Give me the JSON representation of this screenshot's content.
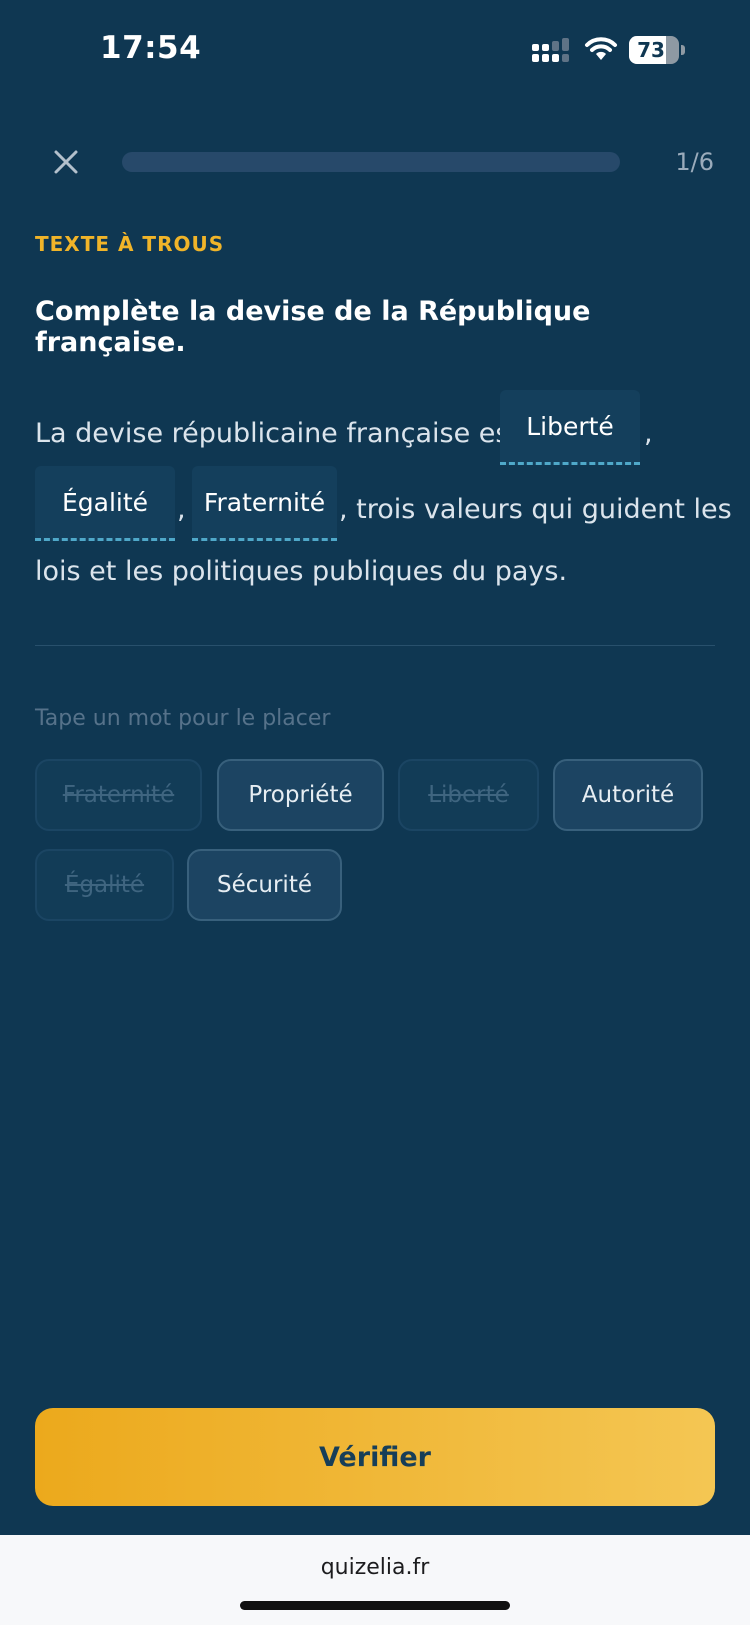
{
  "status_bar": {
    "time": "17:54",
    "battery": "73",
    "battery_level": 0.73,
    "icons": [
      "signal-icon",
      "wifi-icon",
      "battery-icon"
    ]
  },
  "header": {
    "close_icon": "close-icon",
    "progress": 0.0,
    "count": "1/6"
  },
  "exercise": {
    "type_label": "TEXTE À TROUS",
    "question": "Complète la devise de la République française.",
    "sentence": {
      "part1": "La devise républicaine française est",
      "blank1": "Liberté",
      "comma1": ",",
      "blank2": "Égalité",
      "comma2": ",",
      "blank3": "Fraternité",
      "part2": ", trois valeurs qui guident les",
      "part3": "lois et les politiques publiques du pays."
    }
  },
  "word_bank": {
    "hint": "Tape un mot pour le placer",
    "chips": [
      {
        "label": "Fraternité",
        "used": true
      },
      {
        "label": "Propriété",
        "used": false
      },
      {
        "label": "Liberté",
        "used": true
      },
      {
        "label": "Autorité",
        "used": false
      },
      {
        "label": "Égalité",
        "used": true
      },
      {
        "label": "Sécurité",
        "used": false
      }
    ]
  },
  "footer": {
    "verify_label": "Vérifier"
  },
  "browser": {
    "url": "quizelia.fr"
  },
  "colors": {
    "background": "#0f3752",
    "accent": "#f0b429",
    "blank_underline": "#4fa8c9"
  }
}
